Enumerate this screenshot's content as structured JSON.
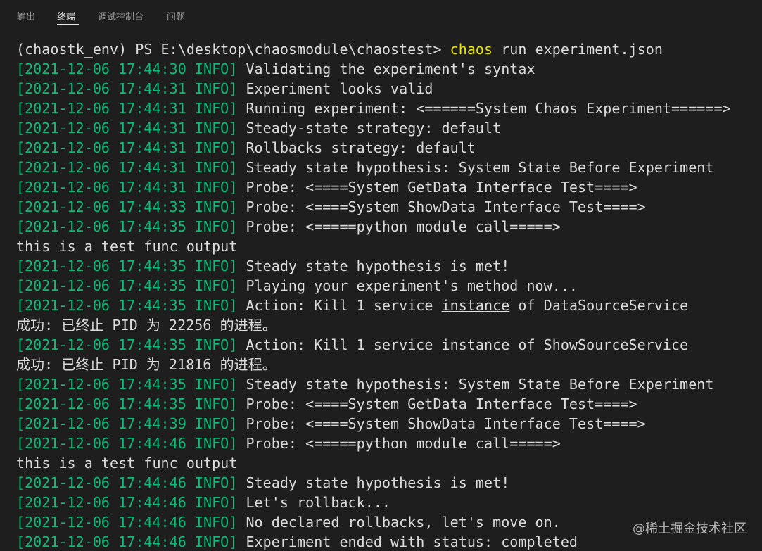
{
  "tabs": [
    {
      "label": "输出",
      "active": false
    },
    {
      "label": "终端",
      "active": true
    },
    {
      "label": "调试控制台",
      "active": false
    },
    {
      "label": "问题",
      "active": false
    }
  ],
  "terminal": {
    "prompt": "(chaostk_env) PS E:\\desktop\\chaosmodule\\chaostest> ",
    "command": "chaos",
    "command_args": " run experiment.json",
    "logs": {
      "l1": {
        "ts": "[2021-12-06 17:44:30 INFO]",
        "msg": " Validating the experiment's syntax"
      },
      "l2": {
        "ts": "[2021-12-06 17:44:31 INFO]",
        "msg": " Experiment looks valid"
      },
      "l3": {
        "ts": "[2021-12-06 17:44:31 INFO]",
        "msg": " Running experiment: <======System Chaos Experiment======>"
      },
      "l4": {
        "ts": "[2021-12-06 17:44:31 INFO]",
        "msg": " Steady-state strategy: default"
      },
      "l5": {
        "ts": "[2021-12-06 17:44:31 INFO]",
        "msg": " Rollbacks strategy: default"
      },
      "l6": {
        "ts": "[2021-12-06 17:44:31 INFO]",
        "msg": " Steady state hypothesis: System State Before Experiment"
      },
      "l7": {
        "ts": "[2021-12-06 17:44:31 INFO]",
        "msg": " Probe: <====System GetData Interface Test====>"
      },
      "l8": {
        "ts": "[2021-12-06 17:44:33 INFO]",
        "msg": " Probe: <====System ShowData Interface Test====>"
      },
      "l9": {
        "ts": "[2021-12-06 17:44:35 INFO]",
        "msg": " Probe: <=====python module call=====>"
      },
      "l10": {
        "text": "this is a test func output"
      },
      "l11": {
        "ts": "[2021-12-06 17:44:35 INFO]",
        "msg": " Steady state hypothesis is met!"
      },
      "l12": {
        "ts": "[2021-12-06 17:44:35 INFO]",
        "msg": " Playing your experiment's method now..."
      },
      "l13": {
        "ts": "[2021-12-06 17:44:35 INFO]",
        "msg_a": " Action: Kill 1 service ",
        "msg_u": "instance",
        "msg_b": " of DataSourceService"
      },
      "l14": {
        "text": "成功: 已终止 PID 为 22256 的进程。"
      },
      "l15": {
        "ts": "[2021-12-06 17:44:35 INFO]",
        "msg": " Action: Kill 1 service instance of ShowSourceService"
      },
      "l16": {
        "text": "成功: 已终止 PID 为 21816 的进程。"
      },
      "l17": {
        "ts": "[2021-12-06 17:44:35 INFO]",
        "msg": " Steady state hypothesis: System State Before Experiment"
      },
      "l18": {
        "ts": "[2021-12-06 17:44:35 INFO]",
        "msg": " Probe: <====System GetData Interface Test====>"
      },
      "l19": {
        "ts": "[2021-12-06 17:44:39 INFO]",
        "msg": " Probe: <====System ShowData Interface Test====>"
      },
      "l20": {
        "ts": "[2021-12-06 17:44:46 INFO]",
        "msg": " Probe: <=====python module call=====>"
      },
      "l21": {
        "text": "this is a test func output"
      },
      "l22": {
        "ts": "[2021-12-06 17:44:46 INFO]",
        "msg": " Steady state hypothesis is met!"
      },
      "l23": {
        "ts": "[2021-12-06 17:44:46 INFO]",
        "msg": " Let's rollback..."
      },
      "l24": {
        "ts": "[2021-12-06 17:44:46 INFO]",
        "msg": " No declared rollbacks, let's move on."
      },
      "l25": {
        "ts": "[2021-12-06 17:44:46 INFO]",
        "msg": " Experiment ended with status: completed"
      }
    }
  },
  "watermark": "@稀土掘金技术社区",
  "colors": {
    "background": "#1e1e1e",
    "timestamp": "#0dbc79",
    "command": "#e5e510",
    "text": "#dcdcdc"
  }
}
